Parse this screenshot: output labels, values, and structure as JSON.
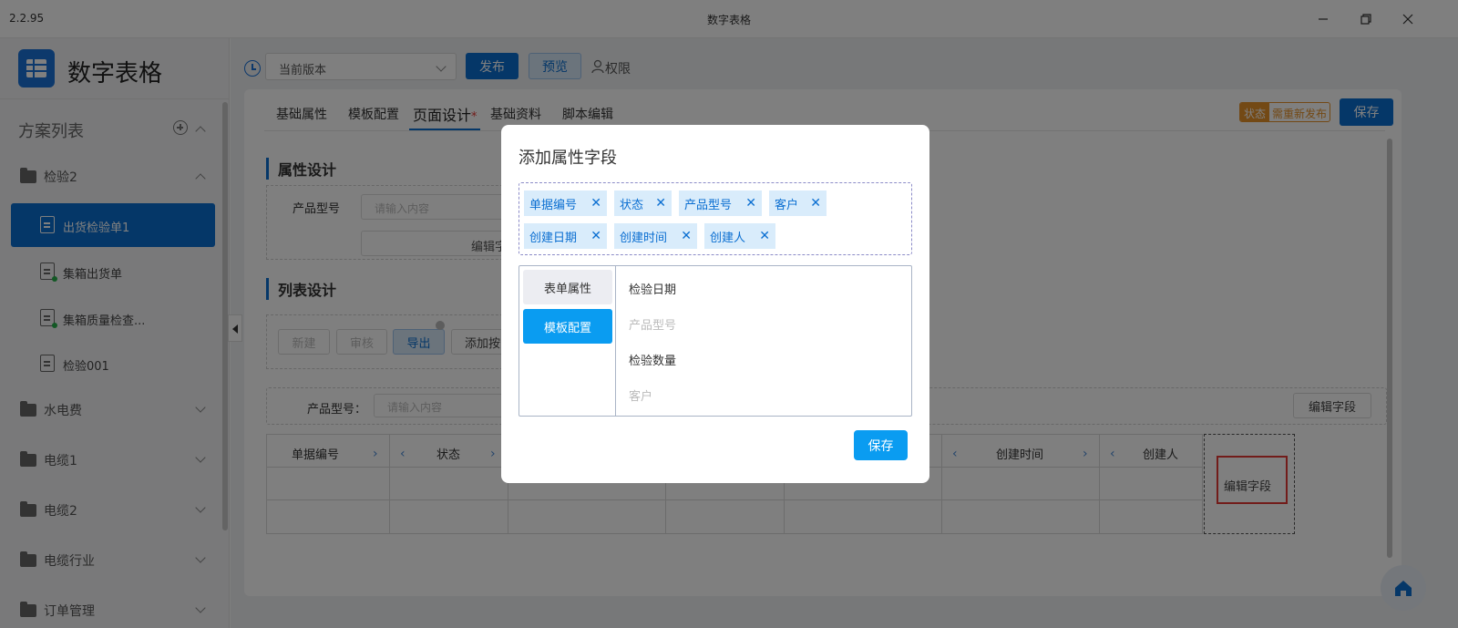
{
  "window": {
    "version": "2.2.95",
    "title": "数字表格"
  },
  "sidebar": {
    "app_name": "数字表格",
    "plan_list_title": "方案列表",
    "groups": [
      {
        "label": "检验2",
        "items": [
          "出货检验单1",
          "集箱出货单",
          "集箱质量检查...",
          "检验001"
        ]
      },
      {
        "label": "水电费"
      },
      {
        "label": "电缆1"
      },
      {
        "label": "电缆2"
      },
      {
        "label": "电缆行业"
      },
      {
        "label": "订单管理"
      }
    ]
  },
  "toolbar": {
    "version_select": "当前版本",
    "publish": "发布",
    "preview": "预览",
    "permission": "权限"
  },
  "tabs": [
    "基础属性",
    "模板配置",
    "页面设计",
    "基础资料",
    "脚本编辑"
  ],
  "tab_required_mark": "*",
  "status": {
    "key": "状态",
    "value": "需重新发布"
  },
  "save_button": "保存",
  "attr_design": {
    "title": "属性设计",
    "field_label": "产品型号",
    "placeholder": "请输入内容",
    "edit_button": "编辑字段"
  },
  "list_design": {
    "title": "列表设计",
    "buttons": [
      "新建",
      "审核",
      "导出",
      "添加按"
    ],
    "filter_label": "产品型号：",
    "filter_placeholder": "请输入内容",
    "edit_field_button": "编辑字段",
    "columns": [
      "单据编号",
      "状态",
      "创建时间",
      "创建人"
    ],
    "edit_field_cell": "编辑字段"
  },
  "dialog": {
    "title": "添加属性字段",
    "tags": [
      "单据编号",
      "状态",
      "产品型号",
      "客户",
      "创建日期",
      "创建时间",
      "创建人"
    ],
    "categories": [
      "表单属性",
      "模板配置"
    ],
    "fields": [
      {
        "label": "检验日期",
        "enabled": true
      },
      {
        "label": "产品型号",
        "enabled": false
      },
      {
        "label": "检验数量",
        "enabled": true
      },
      {
        "label": "客户",
        "enabled": false
      }
    ],
    "save": "保存"
  },
  "colors": {
    "primary": "#0a6ed1",
    "accent": "#0a9cf1",
    "warning": "#e6922a",
    "highlight": "#e53935"
  }
}
